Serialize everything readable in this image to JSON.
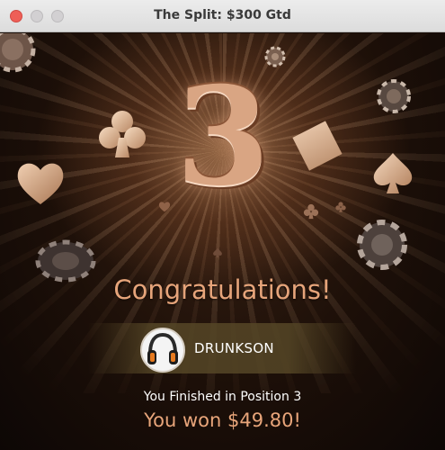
{
  "window": {
    "title": "The Split: $300 Gtd"
  },
  "result": {
    "position_number": "3",
    "headline": "Congratulations!",
    "player_name": "DRUNKSON",
    "finish_text": "You Finished in Position 3",
    "winnings_text": "You won $49.80!"
  },
  "colors": {
    "accent_copper": "#e6a47a",
    "background_dark": "#1a0f09",
    "player_band": "#55462a"
  },
  "icons": {
    "avatar": "headphones-avatar-icon",
    "decorations": [
      "club-icon",
      "heart-icon",
      "diamond-icon",
      "spade-icon",
      "poker-chip-icon"
    ]
  }
}
